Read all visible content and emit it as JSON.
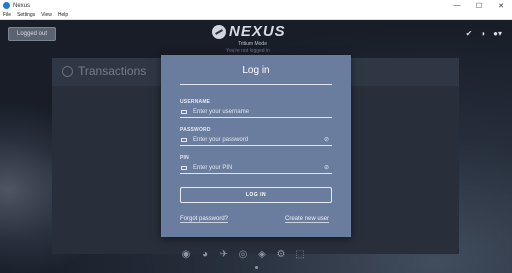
{
  "window": {
    "title": "Nexus",
    "min": "—",
    "max": "☐",
    "close": "✕"
  },
  "menu": [
    "File",
    "Settings",
    "View",
    "Help"
  ],
  "header": {
    "logged_out_label": "Logged out",
    "logo_text": "NEXUS",
    "mode_text": "Tritium Mode",
    "mode_sub": "You're not logged in",
    "icons": [
      "check-icon",
      "half-circle-icon",
      "user-icon"
    ]
  },
  "transactions": {
    "title": "Transactions"
  },
  "login": {
    "title": "Log in",
    "username_label": "USERNAME",
    "username_placeholder": "Enter your username",
    "password_label": "PASSWORD",
    "password_placeholder": "Enter your password",
    "pin_label": "PIN",
    "pin_placeholder": "Enter your PIN",
    "submit_label": "LOG IN",
    "forgot_label": "Forgot password?",
    "create_label": "Create new user"
  },
  "bottom_nav": [
    "◉",
    "◕",
    "✈",
    "◎",
    "◈",
    "⚙",
    "⬚"
  ]
}
